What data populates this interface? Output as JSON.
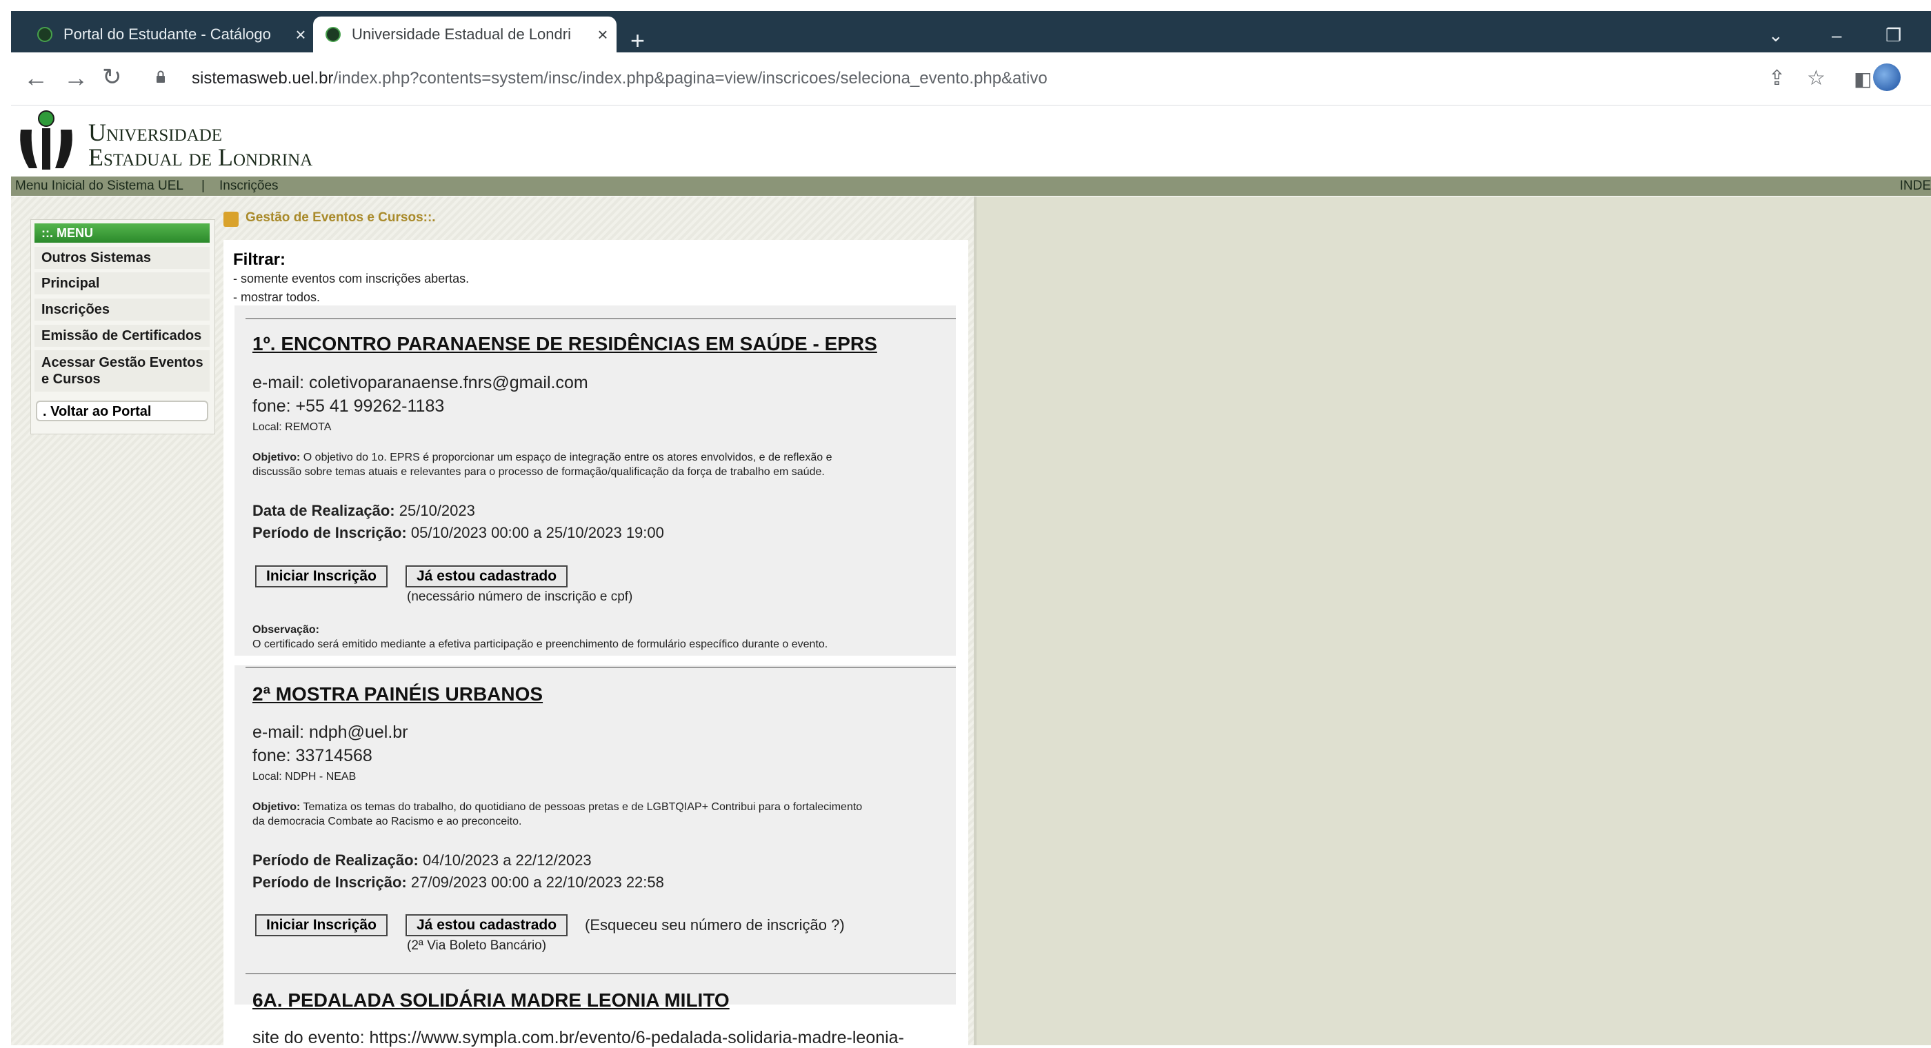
{
  "browser": {
    "tabs": [
      {
        "title": "Portal do Estudante - Catálogo",
        "active": false
      },
      {
        "title": "Universidade Estadual de Londri",
        "active": true
      }
    ],
    "new_tab": "+",
    "url_host": "sistemasweb.uel.br",
    "url_path": "/index.php?contents=system/insc/index.php&pagina=view/inscricoes/seleciona_evento.php&ativo"
  },
  "header": {
    "logo_line1": "Universidade",
    "logo_line2": "Estadual de Londrina"
  },
  "topnav": {
    "menu_inicial": "Menu Inicial do Sistema UEL",
    "separator": "|",
    "inscricoes": "Inscrições",
    "right": "INDE"
  },
  "menu": {
    "heading": "::. MENU",
    "items": [
      "Outros Sistemas",
      "Principal",
      "Inscrições",
      "Emissão de Certificados",
      "Acessar Gestão Eventos e Cursos"
    ],
    "back": ". Voltar ao Portal"
  },
  "main": {
    "title": "Gestão de Eventos e Cursos::.",
    "filter_label": "Filtrar:",
    "filter_open": "- somente eventos com inscrições abertas.",
    "filter_all": "- mostrar todos."
  },
  "events": [
    {
      "title": "1º. ENCONTRO PARANAENSE DE RESIDÊNCIAS EM SAÚDE - EPRS",
      "email": "e-mail: coletivoparanaense.fnrs@gmail.com",
      "phone": "fone: +55 41 99262-1183",
      "local": "Local: REMOTA",
      "objective_label": "Objetivo:",
      "objective_line1": " O objetivo do 1o. EPRS é proporcionar um espaço de integração entre os atores envolvidos, e de reflexão e",
      "objective_line2": "discussão sobre temas atuais e relevantes para o processo de formação/qualificação da força de trabalho em saúde.",
      "date_label": "Data de Realização:",
      "date_value": "25/10/2023",
      "period_label": "Período de Inscrição:",
      "period_value": "05/10/2023 00:00 a 25/10/2023 19:00",
      "btn_start": "Iniciar Inscrição",
      "btn_registered": "Já estou cadastrado",
      "note": "(necessário número de inscrição e cpf)",
      "obs_label": "Observação:",
      "obs_text": "O certificado será emitido mediante a efetiva participação e preenchimento de formulário específico durante o evento."
    },
    {
      "title": "2ª MOSTRA PAINÉIS URBANOS",
      "email": "e-mail: ndph@uel.br",
      "phone": "fone: 33714568",
      "local": "Local: NDPH - NEAB",
      "objective_label": "Objetivo:",
      "objective_line1": " Tematiza os temas do trabalho, do quotidiano de pessoas pretas e de LGBTQIAP+ Contribui para o fortalecimento",
      "objective_line2": "da democracia Combate ao Racismo e ao preconceito.",
      "date_label": "Período de Realização:",
      "date_value": "04/10/2023 a 22/12/2023",
      "period_label": "Período de Inscrição:",
      "period_value": "27/09/2023 00:00 a 22/10/2023 22:58",
      "btn_start": "Iniciar Inscrição",
      "btn_registered": "Já estou cadastrado",
      "forgot": "(Esqueceu seu número de inscrição ?)",
      "note": "(2ª Via Boleto Bancário)"
    },
    {
      "title": "6A. PEDALADA SOLIDÁRIA MADRE LEONIA MILITO",
      "site": "site do evento: https://www.sympla.com.br/evento/6-pedalada-solidaria-madre-leonia-"
    }
  ]
}
